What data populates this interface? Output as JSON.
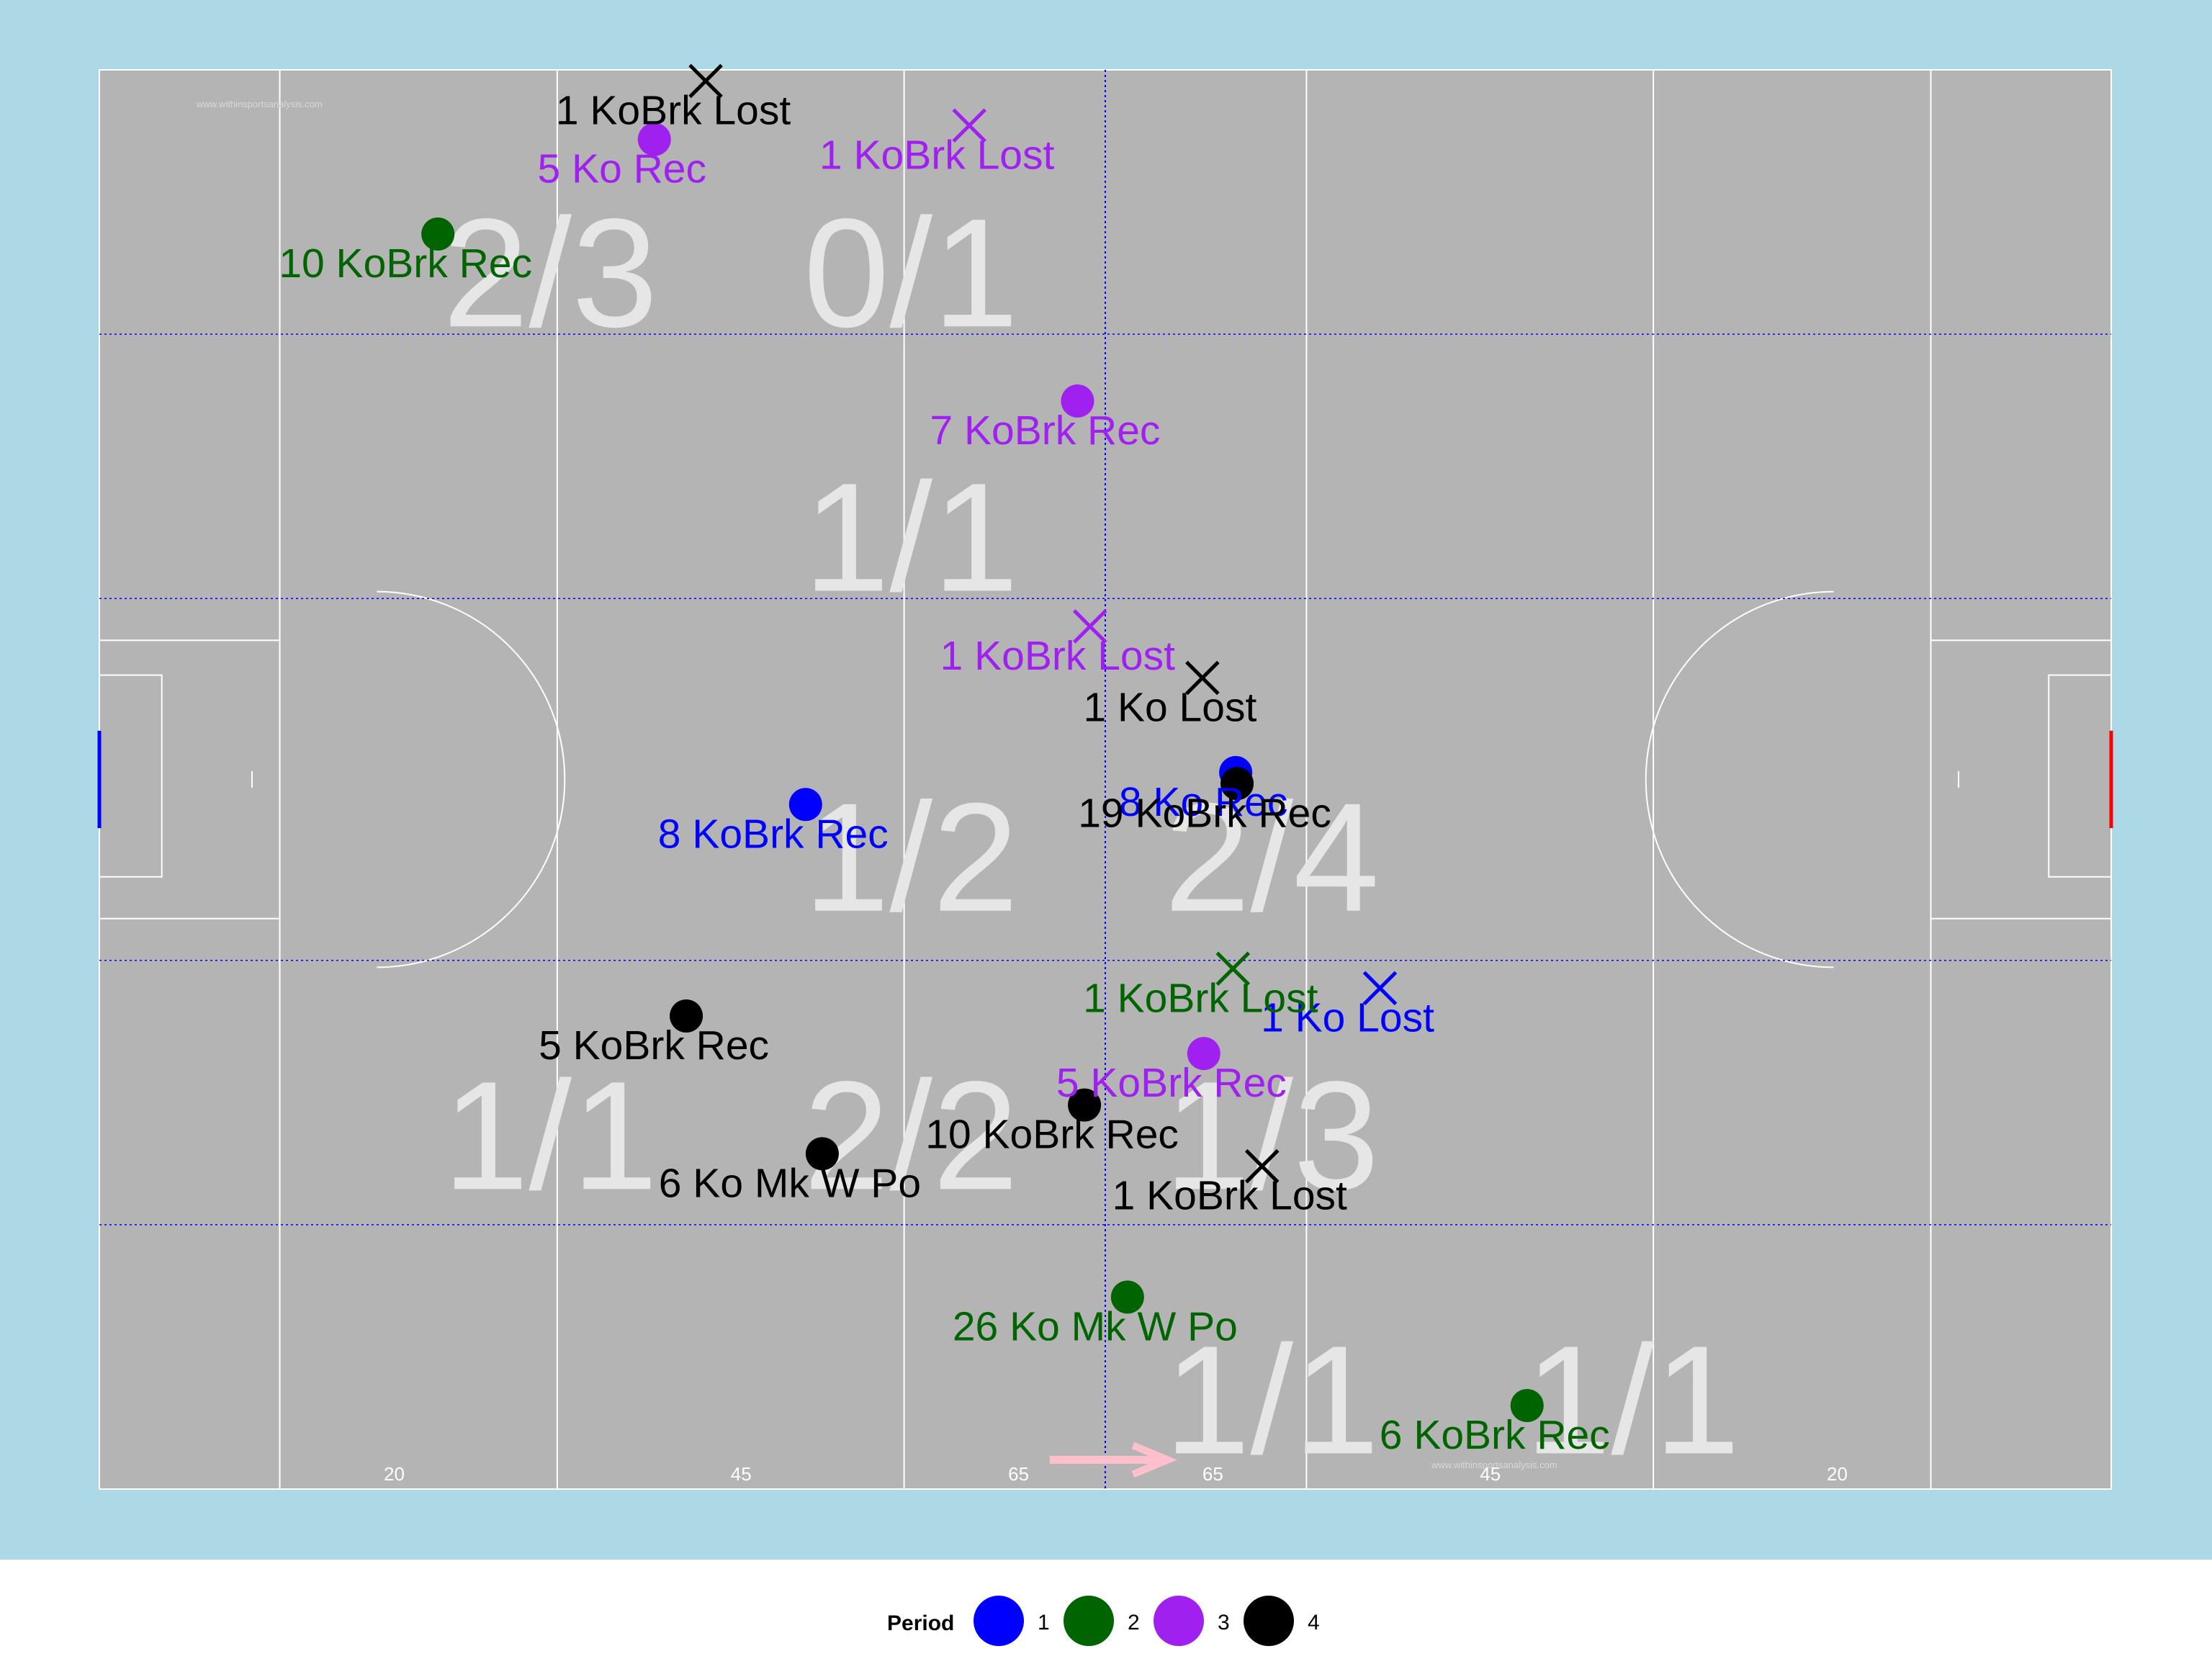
{
  "colors": {
    "period_1": "#0000ff",
    "period_2": "#006400",
    "period_3": "#a020f0",
    "period_4": "#000000",
    "plot_background": "#add8e6",
    "pitch": "#b4b4b4",
    "lines": "#ffffff",
    "zone_lines": "#0000ff",
    "zone_labels": "#e6e6e6",
    "arrow": "#ffc0cb",
    "left_goal": "#0000ff",
    "right_goal": "#ff0000"
  },
  "pitch": {
    "watermark": "www.withinsportsanalysis.com",
    "distance_labels": [
      "20",
      "45",
      "65",
      "65",
      "45",
      "20"
    ]
  },
  "legend": {
    "title": "Period",
    "items": [
      {
        "label": "1",
        "color": "#0000ff"
      },
      {
        "label": "2",
        "color": "#006400"
      },
      {
        "label": "3",
        "color": "#a020f0"
      },
      {
        "label": "4",
        "color": "#000000"
      }
    ]
  },
  "chart_data": {
    "type": "scatter",
    "title": "",
    "xlabel": "",
    "ylabel": "",
    "xlim": [
      0,
      145
    ],
    "ylim": [
      0,
      102
    ],
    "grid": false,
    "legend_position": "bottom",
    "zone_stats": [
      {
        "label": "2/3",
        "x": 32.5,
        "y": 87.5
      },
      {
        "label": "0/1",
        "x": 58.5,
        "y": 87.5
      },
      {
        "label": "1/1",
        "x": 58.5,
        "y": 68.5
      },
      {
        "label": "1/2",
        "x": 58.5,
        "y": 45.5
      },
      {
        "label": "2/4",
        "x": 84.5,
        "y": 45.5
      },
      {
        "label": "1/1",
        "x": 32.5,
        "y": 25.5
      },
      {
        "label": "2/2",
        "x": 58.5,
        "y": 25.5
      },
      {
        "label": "1/3",
        "x": 84.5,
        "y": 25.5
      },
      {
        "label": "1/1",
        "x": 84.5,
        "y": 6.5
      },
      {
        "label": "1/1",
        "x": 110.5,
        "y": 6.5
      }
    ],
    "series": [
      {
        "name": "1",
        "color": "#0000ff",
        "points": [
          {
            "x": 50.9,
            "y": 49.2,
            "outcome": "won",
            "label": "8 KoBrk Rec"
          },
          {
            "x": 81.9,
            "y": 51.5,
            "outcome": "won",
            "label": "8 Ko Rec"
          },
          {
            "x": 92.3,
            "y": 36.0,
            "outcome": "lost",
            "label": "1 Ko Lost"
          }
        ]
      },
      {
        "name": "2",
        "color": "#006400",
        "points": [
          {
            "x": 24.4,
            "y": 90.2,
            "outcome": "won",
            "label": "10 KoBrk Rec"
          },
          {
            "x": 81.7,
            "y": 37.4,
            "outcome": "lost",
            "label": "1 KoBrk Lost"
          },
          {
            "x": 74.1,
            "y": 13.8,
            "outcome": "won",
            "label": "26 Ko Mk W Po"
          },
          {
            "x": 102.9,
            "y": 6.0,
            "outcome": "won",
            "label": "6 KoBrk Rec"
          }
        ]
      },
      {
        "name": "3",
        "color": "#a020f0",
        "points": [
          {
            "x": 40.0,
            "y": 97.0,
            "outcome": "won",
            "label": "5 Ko Rec"
          },
          {
            "x": 62.7,
            "y": 98.0,
            "outcome": "lost",
            "label": "1 KoBrk Lost"
          },
          {
            "x": 70.5,
            "y": 78.2,
            "outcome": "won",
            "label": "7 KoBrk Rec"
          },
          {
            "x": 71.4,
            "y": 62.0,
            "outcome": "lost",
            "label": "1 KoBrk Lost"
          },
          {
            "x": 79.6,
            "y": 31.3,
            "outcome": "won",
            "label": "5 KoBrk Rec"
          }
        ]
      },
      {
        "name": "4",
        "color": "#000000",
        "points": [
          {
            "x": 43.7,
            "y": 101.2,
            "outcome": "lost",
            "label": "1 KoBrk Lost"
          },
          {
            "x": 79.5,
            "y": 58.3,
            "outcome": "lost",
            "label": "1 Ko Lost"
          },
          {
            "x": 82.0,
            "y": 50.7,
            "outcome": "won",
            "label": "19 KoBrk Rec"
          },
          {
            "x": 42.3,
            "y": 34.0,
            "outcome": "won",
            "label": "5 KoBrk Rec"
          },
          {
            "x": 71.0,
            "y": 27.6,
            "outcome": "won",
            "label": "10 KoBrk Rec"
          },
          {
            "x": 52.1,
            "y": 24.1,
            "outcome": "won",
            "label": "6 Ko Mk W Po"
          },
          {
            "x": 83.8,
            "y": 23.2,
            "outcome": "lost",
            "label": "1 KoBrk Lost"
          }
        ]
      }
    ]
  }
}
